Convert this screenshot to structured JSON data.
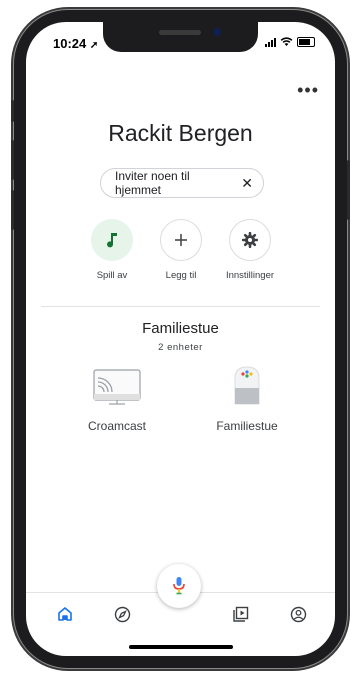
{
  "status_bar": {
    "time": "10:24"
  },
  "header": {
    "title": "Rackit Bergen",
    "menu_icon": "more-horiz-icon"
  },
  "invite_chip": {
    "label": "Inviter noen til hjemmet",
    "close_icon": "close-icon"
  },
  "actions": [
    {
      "label": "Spill av",
      "icon": "music-note-icon"
    },
    {
      "label": "Legg til",
      "icon": "plus-icon"
    },
    {
      "label": "Innstillinger",
      "icon": "gear-icon"
    }
  ],
  "room": {
    "title": "Familiestue",
    "subtitle": "2 enheter",
    "devices": [
      {
        "name": "Croamcast",
        "icon": "chromecast-icon"
      },
      {
        "name": "Familiestue",
        "icon": "google-home-speaker-icon"
      }
    ]
  },
  "fab": {
    "icon": "microphone-icon"
  },
  "bottom_nav": [
    {
      "icon": "home-icon"
    },
    {
      "icon": "compass-icon"
    },
    {
      "icon": "media-library-icon"
    },
    {
      "icon": "account-icon"
    }
  ],
  "colors": {
    "accent_blue": "#1a73e8",
    "green_bg": "#e6f4ea",
    "green_icon": "#137333"
  }
}
